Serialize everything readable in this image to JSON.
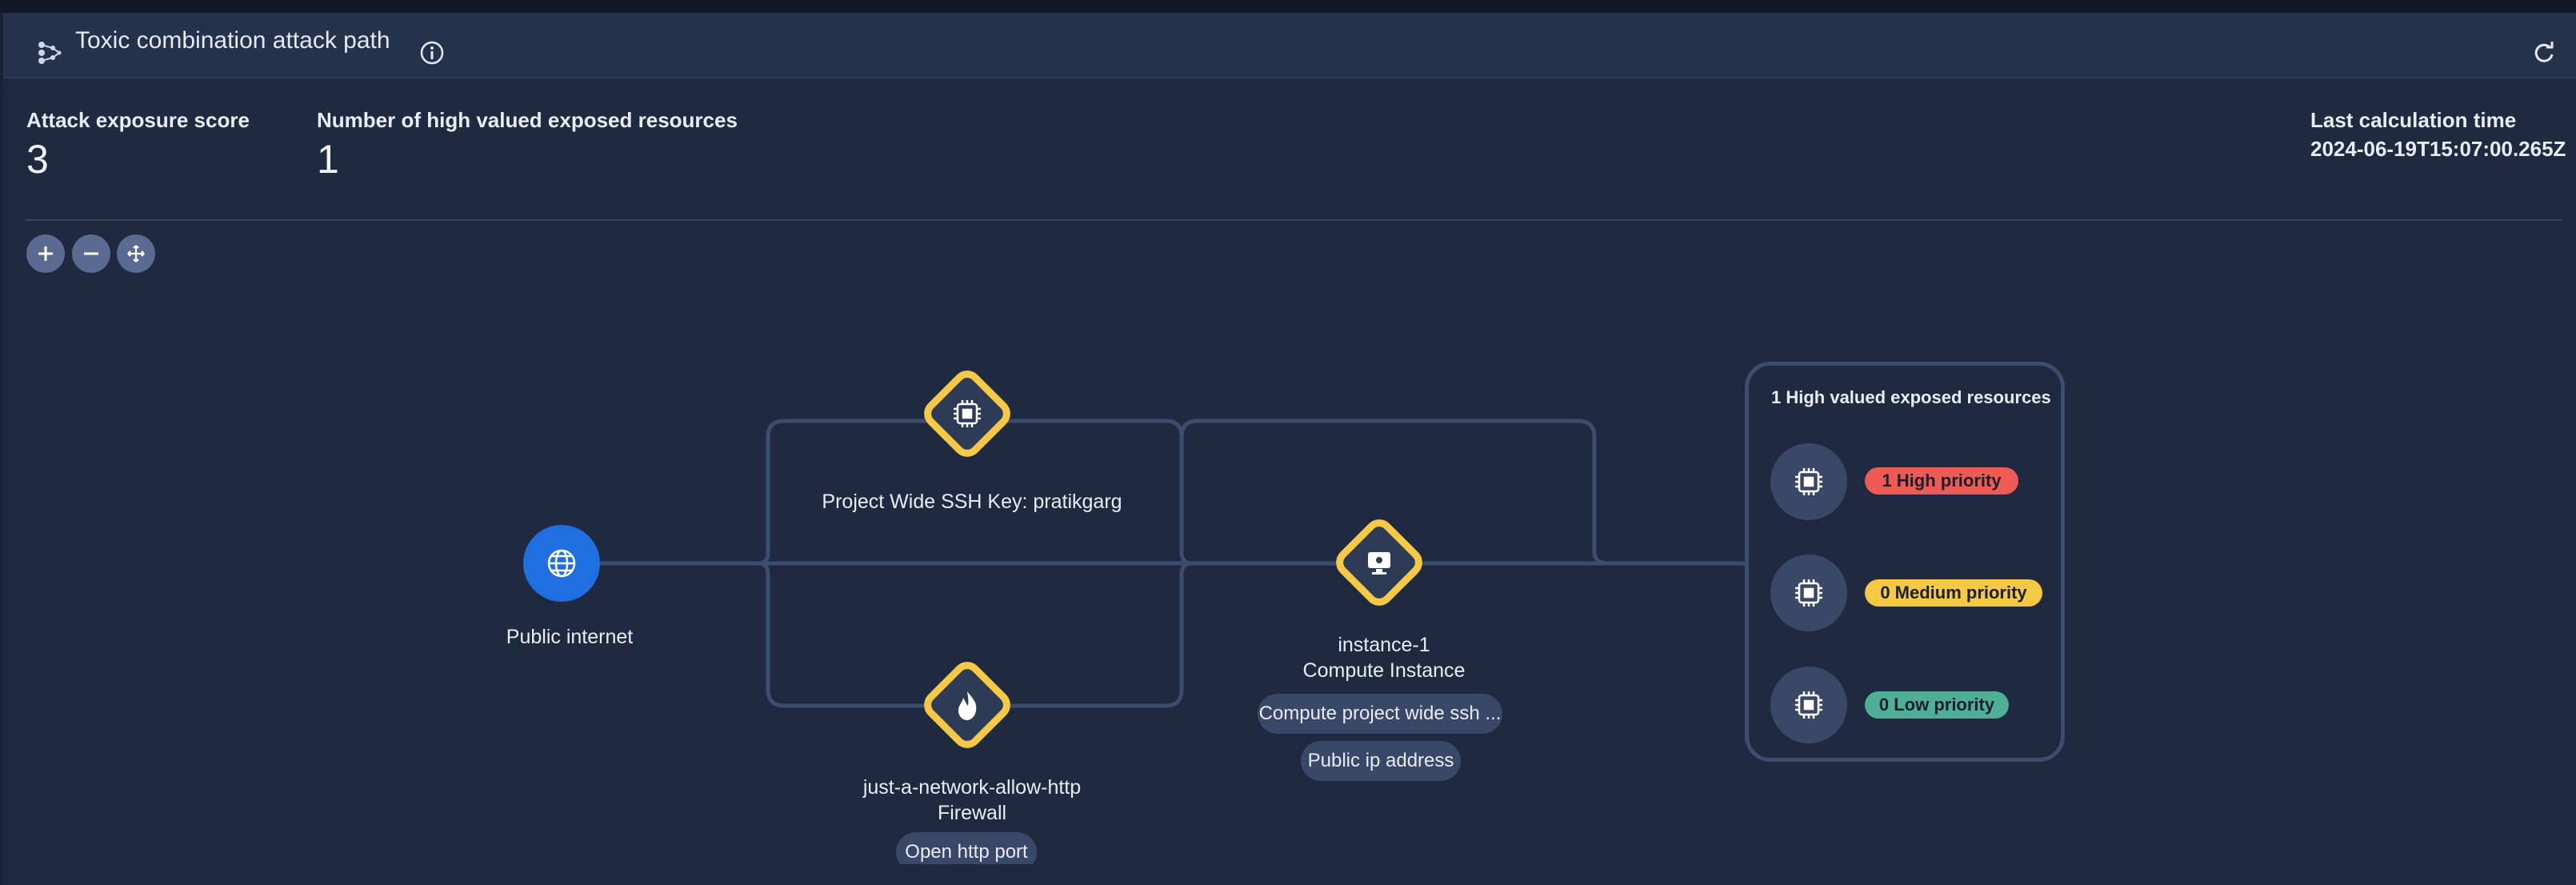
{
  "header": {
    "title": "Toxic combination attack path"
  },
  "metrics": {
    "attack_exposure_label": "Attack exposure score",
    "attack_exposure_value": "3",
    "high_valued_label": "Number of high valued exposed resources",
    "high_valued_value": "1",
    "calc_label": "Last calculation time",
    "calc_value": "2024-06-19T15:07:00.265Z"
  },
  "zoom_controls": [
    "zoom-in-icon",
    "zoom-out-icon",
    "fit-to-view-icon"
  ],
  "graph": {
    "public_internet": {
      "label": "Public internet",
      "icon": "globe-icon"
    },
    "ssh_key": {
      "label": "Project Wide SSH Key: pratikgarg",
      "icon": "chip-icon"
    },
    "firewall": {
      "label": "just-a-network-allow-http",
      "type": "Firewall",
      "icon": "flame-icon",
      "pill": "Open http port"
    },
    "instance": {
      "label": "instance-1",
      "type": "Compute Instance",
      "icon": "monitor-icon",
      "pills": [
        "Compute project wide ssh ...",
        "Public ip address"
      ]
    },
    "high_value_panel": {
      "title": "1 High valued exposed resources",
      "badges": [
        "1 High priority",
        "0 Medium priority",
        "0 Low priority"
      ]
    }
  },
  "colors": {
    "background": "#1f2a40",
    "header": "#25324c",
    "accent_blue": "#1f6fe0",
    "diamond_yellow": "#f6c945",
    "high": "#ee5b55",
    "medium": "#f6c945",
    "low": "#4fae96"
  }
}
